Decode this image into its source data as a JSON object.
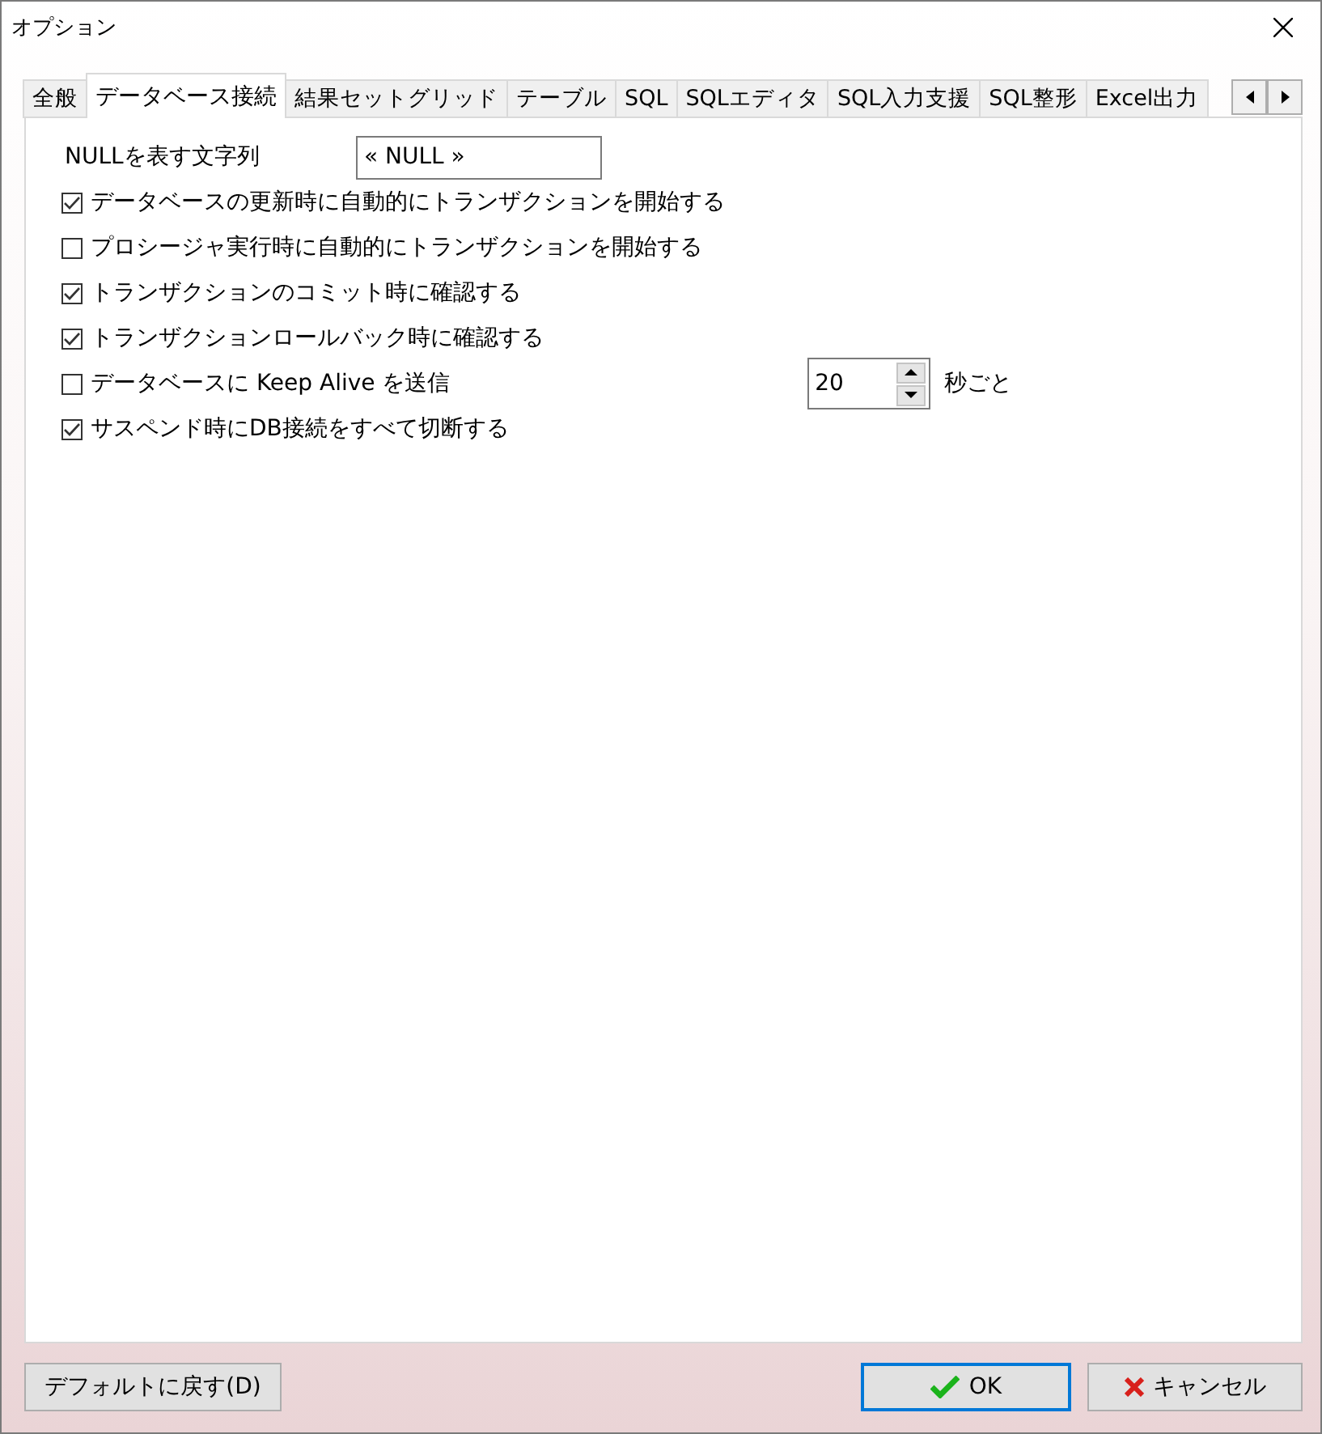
{
  "window": {
    "title": "オプション"
  },
  "tabs": [
    {
      "label": "全般",
      "selected": false
    },
    {
      "label": "データベース接続",
      "selected": true
    },
    {
      "label": "結果セットグリッド",
      "selected": false
    },
    {
      "label": "テーブル",
      "selected": false
    },
    {
      "label": "SQL",
      "selected": false
    },
    {
      "label": "SQLエディタ",
      "selected": false
    },
    {
      "label": "SQL入力支援",
      "selected": false
    },
    {
      "label": "SQL整形",
      "selected": false
    },
    {
      "label": "Excel出力",
      "selected": false
    }
  ],
  "null_string": {
    "label": "NULLを表す文字列",
    "value": "« NULL »"
  },
  "options": [
    {
      "kind": "checkbox",
      "label": "データベースの更新時に自動的にトランザクションを開始する",
      "checked": true
    },
    {
      "kind": "checkbox",
      "label": "プロシージャ実行時に自動的にトランザクションを開始する",
      "checked": false
    },
    {
      "kind": "checkbox",
      "label": "トランザクションのコミット時に確認する",
      "checked": true
    },
    {
      "kind": "checkbox",
      "label": "トランザクションロールバック時に確認する",
      "checked": true
    },
    {
      "kind": "spin",
      "label": "データベースに Keep Alive を送信",
      "checked": false,
      "value": "20",
      "unit": "秒ごと"
    },
    {
      "kind": "checkbox",
      "label": "サスペンド時にDB接続をすべて切断する",
      "checked": true
    }
  ],
  "buttons": [
    {
      "kind": "reset",
      "label": "デフォルトに戻す(D)",
      "focused": false
    },
    {
      "kind": "ok",
      "label": "OK",
      "focused": true
    },
    {
      "kind": "cancel",
      "label": "キャンセル",
      "focused": false
    }
  ]
}
